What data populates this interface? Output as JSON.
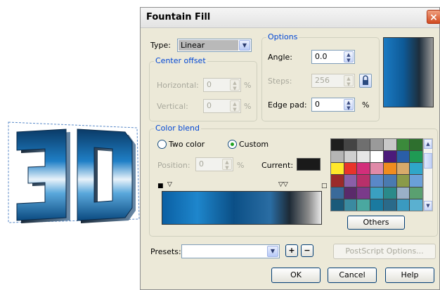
{
  "logo": {
    "text": "3D"
  },
  "dialog": {
    "title": "Fountain Fill",
    "close_label": "×",
    "type": {
      "label": "Type:",
      "value": "Linear"
    },
    "center_offset": {
      "title": "Center offset",
      "horizontal_label": "Horizontal:",
      "horizontal_value": "0",
      "vertical_label": "Vertical:",
      "vertical_value": "0",
      "unit": "%"
    },
    "options": {
      "title": "Options",
      "angle_label": "Angle:",
      "angle_value": "0.0",
      "steps_label": "Steps:",
      "steps_value": "256",
      "edge_pad_label": "Edge pad:",
      "edge_pad_value": "0",
      "unit": "%"
    },
    "color_blend": {
      "title": "Color blend",
      "two_color_label": "Two color",
      "custom_label": "Custom",
      "selected": "Custom",
      "position_label": "Position:",
      "position_value": "0",
      "position_unit": "%",
      "current_label": "Current:",
      "current_color": "#1a1a1a",
      "others_label": "Others",
      "palette": [
        "#1e1e1e",
        "#444444",
        "#6f6f6f",
        "#9a9a9a",
        "#c8c8c8",
        "#3b8a3b",
        "#2e6f2e",
        "#b5b5b5",
        "#cfcfcf",
        "#e6e6e6",
        "#ffffff",
        "#4b1a7a",
        "#2a5ea8",
        "#1f9a54",
        "#ffe82a",
        "#e8332a",
        "#d22e7a",
        "#e08aa8",
        "#f08c1e",
        "#d8aa6a",
        "#2fa6c8",
        "#9a2a2a",
        "#8a5fa8",
        "#b8306a",
        "#5a88c8",
        "#4a7ab0",
        "#8a9a4a",
        "#6aa0d8",
        "#3a6a9a",
        "#5a2a6a",
        "#7a3a8a",
        "#3aa0c0",
        "#2a8a8a",
        "#9ab0c8",
        "#5aa070",
        "#1a5a7a",
        "#3a8aa0",
        "#4aa8a0",
        "#1a7aa0",
        "#2a6a8a",
        "#3a9ac0",
        "#5ab0d0"
      ]
    },
    "presets": {
      "label": "Presets:",
      "value": ""
    },
    "postscript_label": "PostScript Options...",
    "ok_label": "OK",
    "cancel_label": "Cancel",
    "help_label": "Help"
  }
}
